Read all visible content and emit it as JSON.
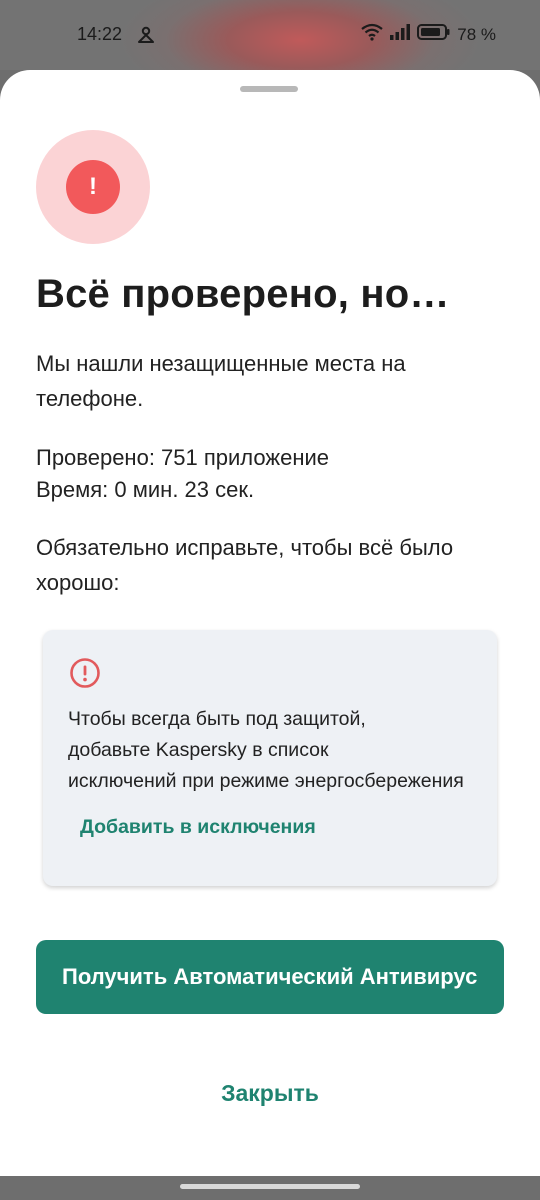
{
  "status_bar": {
    "time": "14:22",
    "battery_text": "78 %",
    "icons": [
      "notification-icon",
      "wifi-icon",
      "signal-icon",
      "battery-icon"
    ]
  },
  "sheet": {
    "hero_icon": "alert-icon",
    "hero_glyph": "!",
    "title": "Всё проверено, но…",
    "message": "Мы нашли незащищенные места на телефоне.",
    "stats": {
      "checked": "Проверено: 751 приложение",
      "time": "Время: 0 мин. 23 сек."
    },
    "fix_prompt": "Обязательно исправьте, чтобы всё было хорошо:",
    "issue_card": {
      "icon": "warning-circle-icon",
      "line1": "Чтобы всегда быть под защитой,",
      "line2": "добавьте Kaspersky в список",
      "line3": "исключений при режиме энергосбережения",
      "action_label": "Добавить в исключения"
    },
    "primary_button": "Получить Автоматический Антивирус",
    "close_button": "Закрыть"
  },
  "colors": {
    "accent": "#1f8370",
    "alert": "#f2595b",
    "alert_bg": "#fbd3d5",
    "card_bg": "#eef1f5"
  }
}
